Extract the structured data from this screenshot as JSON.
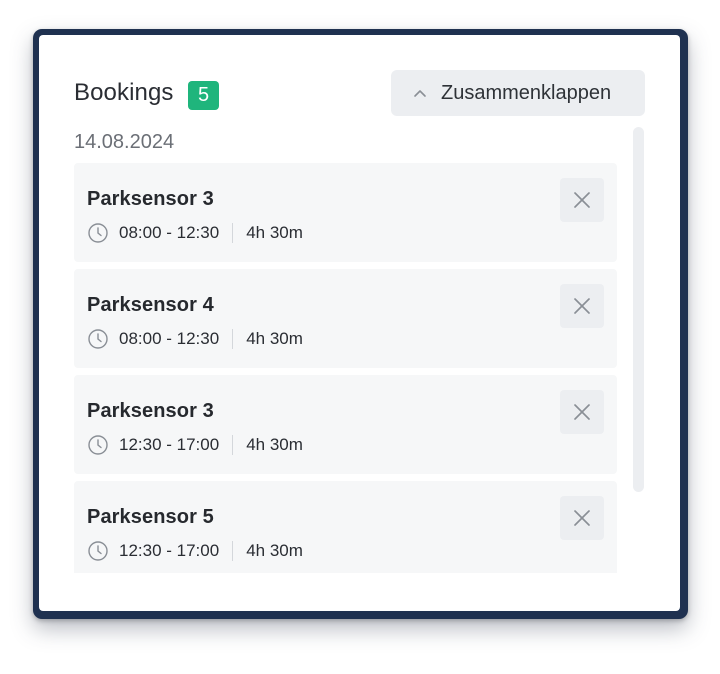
{
  "header": {
    "title": "Bookings",
    "count": "5",
    "collapse_label": "Zusammenklappen"
  },
  "date_group": "14.08.2024",
  "bookings": [
    {
      "name": "Parksensor 3",
      "time": "08:00 - 12:30",
      "duration": "4h 30m"
    },
    {
      "name": "Parksensor 4",
      "time": "08:00 - 12:30",
      "duration": "4h 30m"
    },
    {
      "name": "Parksensor 3",
      "time": "12:30 - 17:00",
      "duration": "4h 30m"
    },
    {
      "name": "Parksensor 5",
      "time": "12:30 - 17:00",
      "duration": "4h 30m"
    }
  ],
  "colors": {
    "frame": "#1f3150",
    "badge": "#1fb57c",
    "card_bg": "#f6f7f8",
    "button_bg": "#eceef1"
  },
  "icons": {
    "collapse": "chevron-up-icon",
    "time": "clock-icon",
    "remove": "close-icon"
  }
}
